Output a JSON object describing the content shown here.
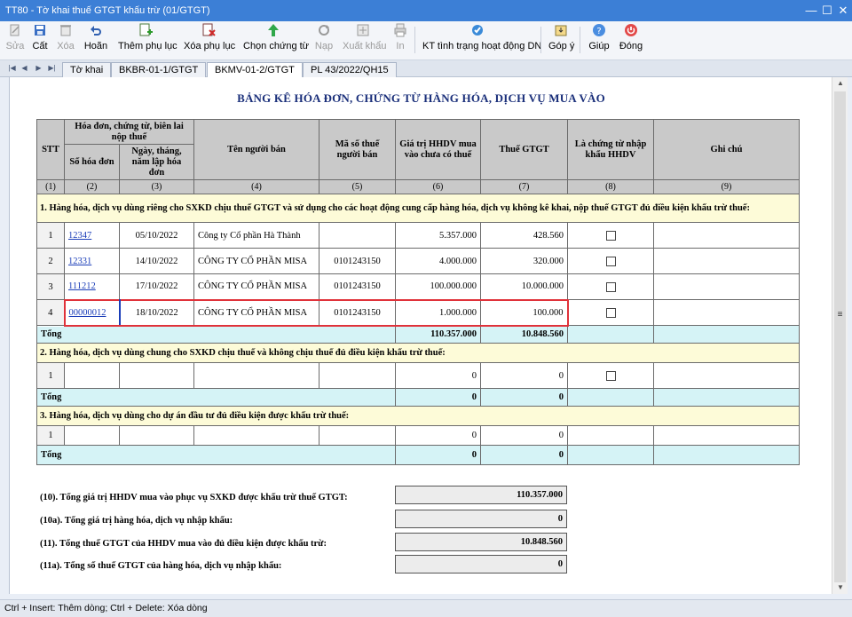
{
  "window": {
    "title": "TT80 - Tờ khai thuế GTGT khấu trừ (01/GTGT)",
    "controls": {
      "minimize": "—",
      "maximize": "☐",
      "close": "✕"
    }
  },
  "toolbar": {
    "buttons": [
      {
        "label": "Sửa",
        "icon": "edit-icon",
        "enabled": false
      },
      {
        "label": "Cất",
        "icon": "save-icon",
        "enabled": true
      },
      {
        "label": "Xóa",
        "icon": "delete-icon",
        "enabled": false
      },
      {
        "label": "Hoãn",
        "icon": "undo-icon",
        "enabled": true
      },
      {
        "label": "Thêm phụ lục",
        "icon": "add-appendix-icon",
        "enabled": true
      },
      {
        "label": "Xóa phụ lục",
        "icon": "remove-appendix-icon",
        "enabled": true
      },
      {
        "label": "Chọn chứng từ",
        "icon": "select-document-icon",
        "enabled": true
      },
      {
        "label": "Nạp",
        "icon": "load-icon",
        "enabled": false
      },
      {
        "label": "Xuất khẩu",
        "icon": "export-icon",
        "enabled": false
      },
      {
        "label": "In",
        "icon": "print-icon",
        "enabled": false
      },
      {
        "label": "KT tình trạng hoạt động DN",
        "icon": "check-status-icon",
        "enabled": true
      },
      {
        "label": "Góp ý",
        "icon": "feedback-icon",
        "enabled": true
      },
      {
        "label": "Giúp",
        "icon": "help-icon",
        "enabled": true
      },
      {
        "label": "Đóng",
        "icon": "close-power-icon",
        "enabled": true
      }
    ]
  },
  "tabs": [
    {
      "label": "Tờ khai",
      "active": false
    },
    {
      "label": "BKBR-01-1/GTGT",
      "active": false
    },
    {
      "label": "BKMV-01-2/GTGT",
      "active": true
    },
    {
      "label": "PL 43/2022/QH15",
      "active": false
    }
  ],
  "sheet": {
    "title": "BẢNG KÊ HÓA ĐƠN, CHỨNG TỪ HÀNG HÓA, DỊCH VỤ MUA VÀO",
    "headers": {
      "stt": "STT",
      "group": "Hóa đơn, chứng từ, biên lai nộp thuế",
      "invoice_no": "Số hóa đơn",
      "invoice_date": "Ngày, tháng, năm lập hóa đơn",
      "seller_name": "Tên người bán",
      "tax_code": "Mã số thuế người bán",
      "value": "Giá trị HHDV mua vào chưa có thuế",
      "vat": "Thuế GTGT",
      "import_doc": "Là chứng từ nhập khẩu HHDV",
      "note": "Ghi chú"
    },
    "col_numbers": [
      "(1)",
      "(2)",
      "(3)",
      "(4)",
      "(5)",
      "(6)",
      "(7)",
      "(8)",
      "(9)"
    ],
    "section1": {
      "title": "1. Hàng hóa, dịch vụ dùng riêng cho SXKD chịu thuế GTGT và sử dụng cho các hoạt động cung cấp hàng hóa, dịch vụ không kê khai, nộp thuế GTGT đủ điều kiện khấu trừ thuế:",
      "rows": [
        {
          "stt": "1",
          "invoice_no": "12347",
          "date": "05/10/2022",
          "seller": "Công ty Cổ phần Hà Thành",
          "tax_code": "",
          "value": "5.357.000",
          "vat": "428.560",
          "import": false,
          "note": ""
        },
        {
          "stt": "2",
          "invoice_no": "12331",
          "date": "14/10/2022",
          "seller": "CÔNG TY CỔ PHẦN MISA",
          "tax_code": "0101243150",
          "value": "4.000.000",
          "vat": "320.000",
          "import": false,
          "note": ""
        },
        {
          "stt": "3",
          "invoice_no": "111212",
          "date": "17/10/2022",
          "seller": "CÔNG TY CỔ PHẦN MISA",
          "tax_code": "0101243150",
          "value": "100.000.000",
          "vat": "10.000.000",
          "import": false,
          "note": ""
        },
        {
          "stt": "4",
          "invoice_no": "00000012",
          "date": "18/10/2022",
          "seller": "CÔNG TY CỔ PHẦN MISA",
          "tax_code": "0101243150",
          "value": "1.000.000",
          "vat": "100.000",
          "import": false,
          "note": ""
        }
      ],
      "total_label": "Tổng",
      "total_value": "110.357.000",
      "total_vat": "10.848.560"
    },
    "section2": {
      "title": "2. Hàng hóa, dịch vụ dùng chung cho SXKD chịu thuế và không chịu thuế đủ điều kiện khấu trừ thuế:",
      "row": {
        "stt": "1",
        "value": "0",
        "vat": "0"
      },
      "total_label": "Tổng",
      "total_value": "0",
      "total_vat": "0"
    },
    "section3": {
      "title": "3. Hàng hóa, dịch vụ dùng cho dự án đầu tư đủ điều kiện được khấu trừ thuế:",
      "row": {
        "stt": "1",
        "value": "0",
        "vat": "0"
      },
      "total_label": "Tổng",
      "total_value": "0",
      "total_vat": "0"
    },
    "summary": [
      {
        "label": "(10). Tổng giá trị HHDV mua vào phục vụ SXKD được khấu trừ thuế GTGT:",
        "value": "110.357.000"
      },
      {
        "label": "(10a). Tổng giá trị hàng hóa, dịch vụ nhập khẩu:",
        "value": "0"
      },
      {
        "label": "(11). Tổng thuế GTGT của HHDV mua vào đủ điều kiện được khấu trừ:",
        "value": "10.848.560"
      },
      {
        "label": "(11a). Tổng số thuế GTGT của hàng hóa, dịch vụ nhập khẩu:",
        "value": "0"
      }
    ]
  },
  "status": {
    "hint": "Ctrl + Insert: Thêm dòng; Ctrl + Delete: Xóa dòng"
  }
}
